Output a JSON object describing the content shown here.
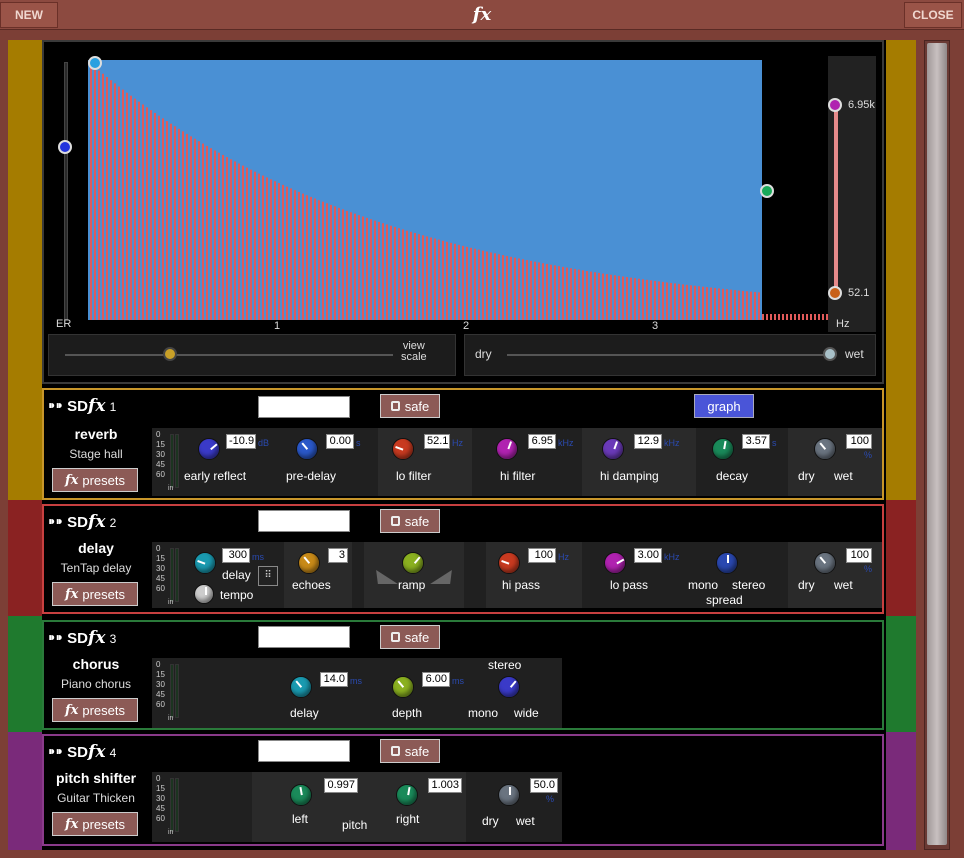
{
  "window": {
    "title": "fx",
    "new_label": "NEW",
    "close_label": "CLOSE"
  },
  "graph": {
    "er_label": "ER",
    "hz_label": "Hz",
    "hi_value": "6.95k",
    "lo_value": "52.1",
    "x_ticks": [
      "1",
      "2",
      "3"
    ],
    "view_scale_label": "view\nscale",
    "dry_label": "dry",
    "wet_label": "wet"
  },
  "modules": [
    {
      "number": "1",
      "type": "reverb",
      "preset_name": "Stage hall",
      "presets_label": "presets",
      "safe_label": "safe",
      "graph_label": "graph",
      "meter_ticks": [
        "0",
        "15",
        "30",
        "45",
        "60"
      ],
      "meter_in": "in",
      "controls": [
        {
          "label": "early reflect",
          "value": "-10.9",
          "unit": "dB",
          "color": "#3a3ac8"
        },
        {
          "label": "pre-delay",
          "value": "0.00",
          "unit": "s",
          "color": "#2a58c8"
        },
        {
          "label": "lo filter",
          "value": "52.1",
          "unit": "Hz",
          "color": "#c83a20"
        },
        {
          "label": "hi filter",
          "value": "6.95",
          "unit": "kHz",
          "color": "#b022b0"
        },
        {
          "label": "hi damping",
          "value": "12.9",
          "unit": "kHz",
          "color": "#6a3ab8"
        },
        {
          "label": "decay",
          "value": "3.57",
          "unit": "s",
          "color": "#1a8a5a"
        },
        {
          "label": "dry",
          "label2": "wet",
          "value": "100",
          "unit": "%",
          "color": "#6a7480"
        }
      ]
    },
    {
      "number": "2",
      "type": "delay",
      "preset_name": "TenTap delay",
      "presets_label": "presets",
      "safe_label": "safe",
      "meter_ticks": [
        "0",
        "15",
        "30",
        "45",
        "60"
      ],
      "meter_in": "in",
      "controls": [
        {
          "label": "delay",
          "value": "300",
          "unit": "ms",
          "color": "#1a9ab0"
        },
        {
          "label": "tempo"
        },
        {
          "label": "echoes",
          "value": "3",
          "color": "#c88a18"
        },
        {
          "label": "ramp",
          "color": "#8ab020"
        },
        {
          "label": "hi pass",
          "value": "100",
          "unit": "Hz",
          "color": "#c83a20"
        },
        {
          "label": "lo pass",
          "value": "3.00",
          "unit": "kHz",
          "color": "#b022b0"
        },
        {
          "label": "mono",
          "label2": "stereo",
          "label3": "spread",
          "color": "#2a48b0"
        },
        {
          "label": "dry",
          "label2": "wet",
          "value": "100",
          "unit": "%",
          "color": "#6a7480"
        }
      ]
    },
    {
      "number": "3",
      "type": "chorus",
      "preset_name": "Piano chorus",
      "presets_label": "presets",
      "safe_label": "safe",
      "meter_ticks": [
        "0",
        "15",
        "30",
        "45",
        "60"
      ],
      "meter_in": "in",
      "controls": [
        {
          "label": "delay",
          "value": "14.0",
          "unit": "ms",
          "color": "#1a9ab0"
        },
        {
          "label": "depth",
          "value": "6.00",
          "unit": "ms",
          "color": "#8ab020"
        },
        {
          "label": "mono",
          "label2": "wide",
          "label3": "stereo",
          "color": "#3a3ac8"
        }
      ]
    },
    {
      "number": "4",
      "type": "pitch shifter",
      "preset_name": "Guitar Thicken",
      "presets_label": "presets",
      "safe_label": "safe",
      "meter_ticks": [
        "0",
        "15",
        "30",
        "45",
        "60"
      ],
      "meter_in": "in",
      "controls": [
        {
          "label": "left",
          "value": "0.997",
          "color": "#1a8a5a"
        },
        {
          "label": "pitch"
        },
        {
          "label": "right",
          "value": "1.003",
          "color": "#1a8a5a"
        },
        {
          "label": "dry",
          "label2": "wet",
          "value": "50.0",
          "unit": "%",
          "color": "#6a7480"
        }
      ]
    }
  ],
  "colors": {
    "reverb": "#a57c00",
    "delay": "#8a2222",
    "chorus": "#1f7a2e",
    "pitch": "#7a2a7a"
  }
}
